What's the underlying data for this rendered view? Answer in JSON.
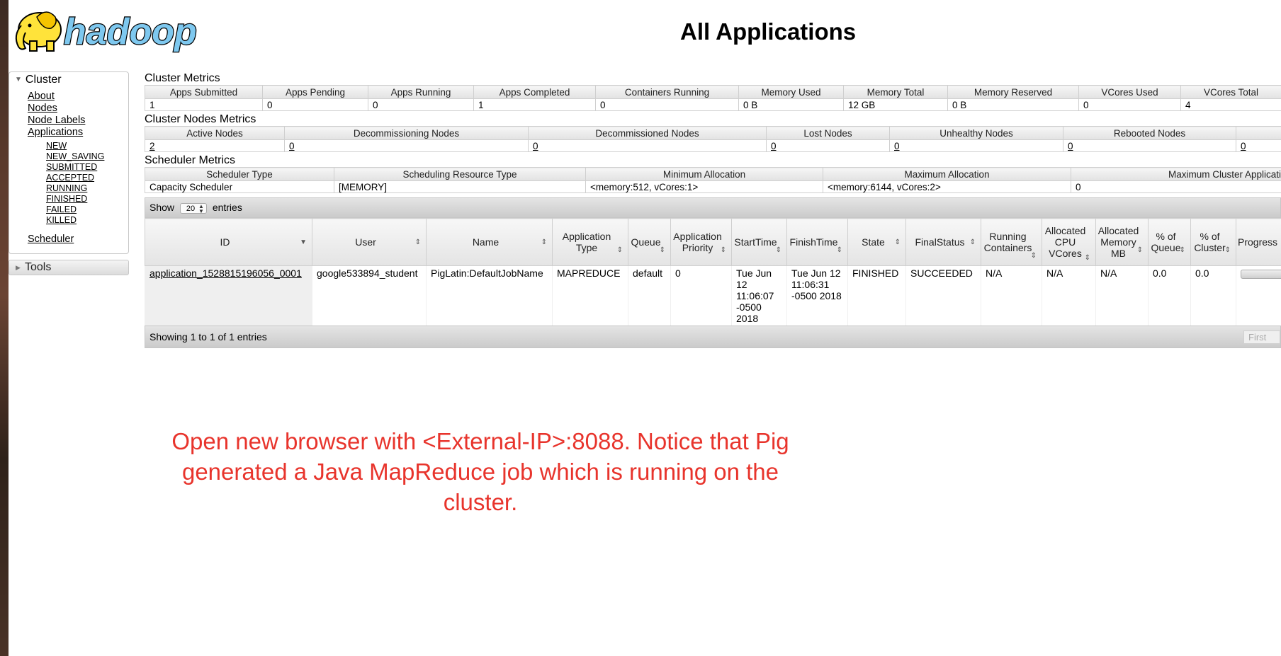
{
  "header": {
    "logo_text": "hadoop",
    "page_title": "All Applications"
  },
  "sidebar": {
    "cluster_label": "Cluster",
    "links": [
      "About",
      "Nodes",
      "Node Labels",
      "Applications"
    ],
    "app_states": [
      "NEW",
      "NEW_SAVING",
      "SUBMITTED",
      "ACCEPTED",
      "RUNNING",
      "FINISHED",
      "FAILED",
      "KILLED"
    ],
    "scheduler_label": "Scheduler",
    "tools_label": "Tools"
  },
  "cluster_metrics": {
    "title": "Cluster Metrics",
    "headers": [
      "Apps Submitted",
      "Apps Pending",
      "Apps Running",
      "Apps Completed",
      "Containers Running",
      "Memory Used",
      "Memory Total",
      "Memory Reserved",
      "VCores Used",
      "VCores Total"
    ],
    "values": [
      "1",
      "0",
      "0",
      "1",
      "0",
      "0 B",
      "12 GB",
      "0 B",
      "0",
      "4"
    ]
  },
  "node_metrics": {
    "title": "Cluster Nodes Metrics",
    "headers": [
      "Active Nodes",
      "Decommissioning Nodes",
      "Decommissioned Nodes",
      "Lost Nodes",
      "Unhealthy Nodes",
      "Rebooted Nodes",
      ""
    ],
    "values": [
      "2",
      "0",
      "0",
      "0",
      "0",
      "0",
      "0"
    ]
  },
  "scheduler_metrics": {
    "title": "Scheduler Metrics",
    "headers": [
      "Scheduler Type",
      "Scheduling Resource Type",
      "Minimum Allocation",
      "Maximum Allocation",
      "Maximum Cluster Applicati"
    ],
    "values": [
      "Capacity Scheduler",
      "[MEMORY]",
      "<memory:512, vCores:1>",
      "<memory:6144, vCores:2>",
      "0"
    ]
  },
  "apps_table": {
    "show_label": "Show",
    "show_value": "20",
    "entries_label": "entries",
    "headers": [
      "ID",
      "User",
      "Name",
      "Application Type",
      "Queue",
      "Application Priority",
      "StartTime",
      "FinishTime",
      "State",
      "FinalStatus",
      "Running Containers",
      "Allocated CPU VCores",
      "Allocated Memory MB",
      "% of Queue",
      "% of Cluster",
      "Progress"
    ],
    "row": {
      "id": "application_1528815196056_0001",
      "user": "google533894_student",
      "name": "PigLatin:DefaultJobName",
      "type": "MAPREDUCE",
      "queue": "default",
      "priority": "0",
      "start_time": "Tue Jun 12 11:06:07 -0500 2018",
      "finish_time": "Tue Jun 12 11:06:31 -0500 2018",
      "state": "FINISHED",
      "final_status": "SUCCEEDED",
      "running_containers": "N/A",
      "cpu_vcores": "N/A",
      "memory_mb": "N/A",
      "pct_queue": "0.0",
      "pct_cluster": "0.0"
    },
    "footer_text": "Showing 1 to 1 of 1 entries",
    "first_label": "First"
  },
  "annotation": "Open new browser with <External-IP>:8088. Notice that Pig generated a Java MapReduce job which is running on the cluster.",
  "colors": {
    "annotation": "#e8342c",
    "logo_blue": "#7ec8ef",
    "logo_yellow": "#ffe33a"
  }
}
